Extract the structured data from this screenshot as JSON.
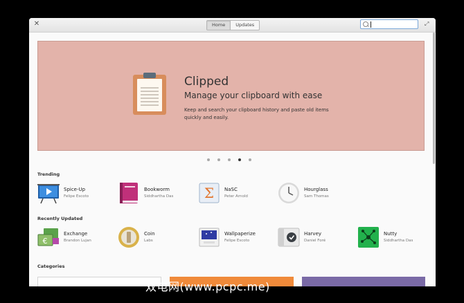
{
  "titlebar": {
    "tabs": [
      {
        "label": "Home",
        "active": true
      },
      {
        "label": "Updates",
        "active": false
      }
    ],
    "search_value": ""
  },
  "banner": {
    "title": "Clipped",
    "subtitle": "Manage your clipboard with ease",
    "description": "Keep and search your clipboard history and paste old items quickly and easily.",
    "background": "#e3b3aa",
    "pages": 5,
    "active_page": 4
  },
  "trending": {
    "title": "Trending",
    "apps": [
      {
        "name": "Spice-Up",
        "author": "Felipe Escoto",
        "icon": "presentation-icon"
      },
      {
        "name": "Bookworm",
        "author": "Siddhartha Das",
        "icon": "book-icon"
      },
      {
        "name": "NaSC",
        "author": "Peter Arnold",
        "icon": "sigma-calculator-icon"
      },
      {
        "name": "Hourglass",
        "author": "Sam Thomas",
        "icon": "clock-icon"
      }
    ]
  },
  "recently_updated": {
    "title": "Recently Updated",
    "apps": [
      {
        "name": "Exchange",
        "author": "Brandon Lujan",
        "icon": "currency-exchange-icon"
      },
      {
        "name": "Coin",
        "author": "Labs",
        "icon": "coin-icon"
      },
      {
        "name": "Wallpaperize",
        "author": "Felipe Escoto",
        "icon": "wallpaper-icon"
      },
      {
        "name": "Harvey",
        "author": "Daniel Foré",
        "icon": "contrast-checker-icon"
      },
      {
        "name": "Nutty",
        "author": "Siddhartha Das",
        "icon": "network-icon"
      }
    ]
  },
  "categories": {
    "title": "Categories",
    "colors": [
      "#ffffff",
      "#f08a3a",
      "#7a6aa6"
    ]
  },
  "watermark": "双电网(www.pcpc.me)"
}
